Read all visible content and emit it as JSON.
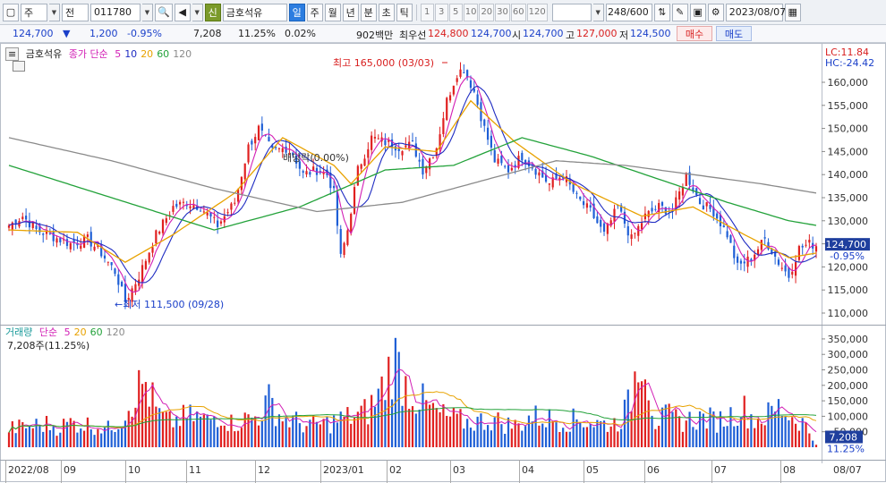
{
  "toolbar": {
    "period_label": "주",
    "prev_label": "전",
    "code": "011780",
    "name_badge": "신",
    "name": "금호석유",
    "tab_day": "일",
    "tab_week": "주",
    "tab_month": "월",
    "tab_year": "년",
    "tab_min": "분",
    "tab_sec": "초",
    "tab_tick": "틱",
    "num_buttons": [
      "1",
      "3",
      "5",
      "10",
      "20",
      "30",
      "60",
      "120"
    ],
    "count": "248",
    "count_total": "/600",
    "date": "2023/08/07"
  },
  "quote": {
    "price": "124,700",
    "change": "1,200",
    "change_rate": "-0.95%",
    "volume": "7,208",
    "turnover_rate": "11.25%",
    "ratio": "0.02%",
    "amount": "902백만",
    "bid_label": "최우선",
    "bid": "124,800",
    "ask": "124,700",
    "open_label": "시",
    "open": "124,700",
    "high_label": "고",
    "high": "127,000",
    "low_label": "저",
    "low": "124,500",
    "buy_label": "매수",
    "sell_label": "매도"
  },
  "price_panel": {
    "name": "금호석유",
    "ma_label": "종가 단순",
    "ma_periods": [
      "5",
      "10",
      "20",
      "60",
      "120"
    ],
    "lc": "LC:11.84",
    "hc": "HC:-24.42",
    "current_tag": "124,700",
    "current_rate": "-0.95%",
    "high_annotation": "최고 165,000 (03/03)",
    "low_annotation": "←최저 111,500 (09/28)",
    "event_annotation": "배당락(0.00%)"
  },
  "volume_panel": {
    "title": "거래량",
    "ma_label": "단순",
    "ma_periods": [
      "5",
      "20",
      "60",
      "120"
    ],
    "last_label": "7,208주(11.25%)",
    "current_tag": "7,208",
    "current_rate": "11.25%"
  },
  "colors": {
    "up": "#e02020",
    "down": "#1f5fd6",
    "ma5": "#d21fb5",
    "ma10": "#1f2cc2",
    "ma20": "#e8a200",
    "ma60": "#23a23a",
    "ma120": "#8a8a8a"
  },
  "chart_data": {
    "type": "candlestick",
    "price_axis": {
      "min": 110000,
      "max": 160000,
      "ticks": [
        "160,000",
        "155,000",
        "150,000",
        "145,000",
        "140,000",
        "135,000",
        "130,000",
        "125,000",
        "120,000",
        "115,000",
        "110,000"
      ]
    },
    "volume_axis": {
      "ticks": [
        "350,000",
        "300,000",
        "250,000",
        "200,000",
        "150,000",
        "100,000",
        "50,000"
      ]
    },
    "x_labels": [
      "2022/08",
      "09",
      "10",
      "11",
      "12",
      "2023/01",
      "02",
      "03",
      "04",
      "05",
      "06",
      "07",
      "08",
      "08/07"
    ],
    "close_path": [
      [
        0,
        129000
      ],
      [
        4,
        131000
      ],
      [
        8,
        128000
      ],
      [
        13,
        126500
      ],
      [
        18,
        125000
      ],
      [
        23,
        126000
      ],
      [
        27,
        123000
      ],
      [
        31,
        119000
      ],
      [
        34,
        112500
      ],
      [
        38,
        118000
      ],
      [
        43,
        127000
      ],
      [
        48,
        133000
      ],
      [
        52,
        134000
      ],
      [
        56,
        133000
      ],
      [
        61,
        129000
      ],
      [
        66,
        134000
      ],
      [
        70,
        146000
      ],
      [
        73,
        150000
      ],
      [
        77,
        145000
      ],
      [
        82,
        146000
      ],
      [
        86,
        140000
      ],
      [
        90,
        141000
      ],
      [
        93,
        140000
      ],
      [
        95,
        136000
      ],
      [
        97,
        122000
      ],
      [
        99,
        128000
      ],
      [
        102,
        141000
      ],
      [
        106,
        148000
      ],
      [
        110,
        147000
      ],
      [
        114,
        146000
      ],
      [
        118,
        146500
      ],
      [
        121,
        141000
      ],
      [
        125,
        146000
      ],
      [
        128,
        156000
      ],
      [
        131,
        162000
      ],
      [
        133,
        163000
      ],
      [
        136,
        158000
      ],
      [
        139,
        150000
      ],
      [
        142,
        143000
      ],
      [
        146,
        141000
      ],
      [
        150,
        144000
      ],
      [
        154,
        141000
      ],
      [
        158,
        138000
      ],
      [
        162,
        140000
      ],
      [
        166,
        135000
      ],
      [
        170,
        132000
      ],
      [
        174,
        127000
      ],
      [
        178,
        133000
      ],
      [
        182,
        126000
      ],
      [
        186,
        131000
      ],
      [
        190,
        133000
      ],
      [
        194,
        132000
      ],
      [
        198,
        140000
      ],
      [
        202,
        134000
      ],
      [
        206,
        132000
      ],
      [
        210,
        127000
      ],
      [
        213,
        120000
      ],
      [
        217,
        122000
      ],
      [
        221,
        126000
      ],
      [
        225,
        121000
      ],
      [
        228,
        118000
      ],
      [
        231,
        124000
      ],
      [
        234,
        125000
      ],
      [
        236,
        124700
      ]
    ],
    "volume_values": [
      60000,
      65000,
      70000,
      75000,
      65000,
      80000,
      75000,
      70000,
      60000,
      90000,
      170000,
      210000,
      105000,
      80000,
      95000,
      100000,
      85000,
      110000,
      75000,
      90000,
      100000,
      150000,
      95000,
      85000,
      70000,
      75000,
      80000,
      95000,
      100000,
      120000,
      185000,
      290000,
      200000,
      155000,
      120000,
      100000,
      90000,
      80000,
      85000,
      90000,
      75000,
      70000,
      100000,
      95000,
      90000,
      85000,
      90000,
      80000,
      75000,
      80000,
      140000,
      365000,
      80000,
      100000,
      85000,
      90000,
      95000,
      85000,
      100000,
      130000,
      90000,
      100000,
      130000,
      100000,
      80000,
      7208
    ],
    "ma_paths": {
      "ma20": [
        [
          0,
          128000
        ],
        [
          20,
          127500
        ],
        [
          34,
          121000
        ],
        [
          48,
          127000
        ],
        [
          66,
          136000
        ],
        [
          80,
          148000
        ],
        [
          95,
          142000
        ],
        [
          100,
          138000
        ],
        [
          110,
          146000
        ],
        [
          125,
          145000
        ],
        [
          135,
          156000
        ],
        [
          148,
          147000
        ],
        [
          165,
          138000
        ],
        [
          185,
          131000
        ],
        [
          200,
          133000
        ],
        [
          215,
          127000
        ],
        [
          228,
          122000
        ],
        [
          236,
          123000
        ]
      ],
      "ma60": [
        [
          0,
          142000
        ],
        [
          30,
          135000
        ],
        [
          60,
          128000
        ],
        [
          85,
          133000
        ],
        [
          110,
          141000
        ],
        [
          130,
          142000
        ],
        [
          150,
          148000
        ],
        [
          170,
          144000
        ],
        [
          190,
          139000
        ],
        [
          210,
          134000
        ],
        [
          228,
          130000
        ],
        [
          236,
          129000
        ]
      ],
      "ma120": [
        [
          0,
          148000
        ],
        [
          30,
          143000
        ],
        [
          60,
          137000
        ],
        [
          90,
          132000
        ],
        [
          115,
          134000
        ],
        [
          140,
          139000
        ],
        [
          160,
          143000
        ],
        [
          180,
          142000
        ],
        [
          200,
          140000
        ],
        [
          220,
          138000
        ],
        [
          236,
          136000
        ]
      ]
    }
  }
}
